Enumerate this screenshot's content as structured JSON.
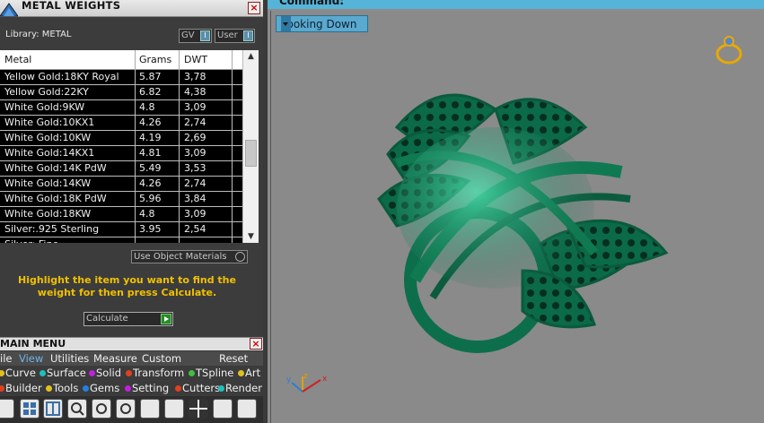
{
  "metal_weights": {
    "title": "METAL WEIGHTS",
    "close": "×",
    "library_label": "Library: METAL",
    "toggle_gv": "GV",
    "toggle_user": "User",
    "toggle_mark": "I",
    "columns": [
      "Metal",
      "Grams",
      "DWT"
    ],
    "rows": [
      {
        "metal": "Yellow Gold:18KY Royal",
        "grams": "5.87",
        "dwt": "3,78"
      },
      {
        "metal": "Yellow Gold:22KY",
        "grams": "6.82",
        "dwt": "4,38"
      },
      {
        "metal": "White Gold:9KW",
        "grams": "4.8",
        "dwt": "3,09"
      },
      {
        "metal": "White Gold:10KX1",
        "grams": "4.26",
        "dwt": "2,74"
      },
      {
        "metal": "White Gold:10KW",
        "grams": "4.19",
        "dwt": "2,69"
      },
      {
        "metal": "White Gold:14KX1",
        "grams": "4.81",
        "dwt": "3,09"
      },
      {
        "metal": "White Gold:14K PdW",
        "grams": "5.49",
        "dwt": "3,53"
      },
      {
        "metal": "White Gold:14KW",
        "grams": "4.26",
        "dwt": "2,74"
      },
      {
        "metal": "White Gold:18K PdW",
        "grams": "5.96",
        "dwt": "3,84"
      },
      {
        "metal": "White Gold:18KW",
        "grams": "4.8",
        "dwt": "3,09"
      },
      {
        "metal": "Silver:.925 Sterling",
        "grams": "3.95",
        "dwt": "2,54"
      },
      {
        "metal": "Silver: Fine",
        "grams": "",
        "dwt": ""
      }
    ],
    "use_object_materials": "Use Object Materials",
    "hint": "Highlight the item you want to find the weight for then press Calculate.",
    "calculate_label": "Calculate"
  },
  "main_menu": {
    "title": "MAIN MENU",
    "tabs": [
      "ile",
      "View",
      "Utilities",
      "Measure",
      "Custom",
      "Reset"
    ],
    "row1": [
      {
        "label": "Curve",
        "color": "#e0c020"
      },
      {
        "label": "Surface",
        "color": "#20c0c0"
      },
      {
        "label": "Solid",
        "color": "#c020e0"
      },
      {
        "label": "Transform",
        "color": "#e04020"
      },
      {
        "label": "TSpline",
        "color": "#40c040"
      },
      {
        "label": "Art",
        "color": "#e0c020"
      }
    ],
    "row2": [
      {
        "label": "Builder",
        "color": "#e04020"
      },
      {
        "label": "Tools",
        "color": "#e0c020"
      },
      {
        "label": "Gems",
        "color": "#2080e0"
      },
      {
        "label": "Setting",
        "color": "#c020e0"
      },
      {
        "label": "Cutters",
        "color": "#e04020"
      },
      {
        "label": "Render",
        "color": "#20c0c0"
      }
    ]
  },
  "viewport": {
    "command_label": "Command:",
    "view_mode": "Looking Down",
    "axis_labels": {
      "x": "x",
      "y": "y",
      "z": "z"
    }
  }
}
